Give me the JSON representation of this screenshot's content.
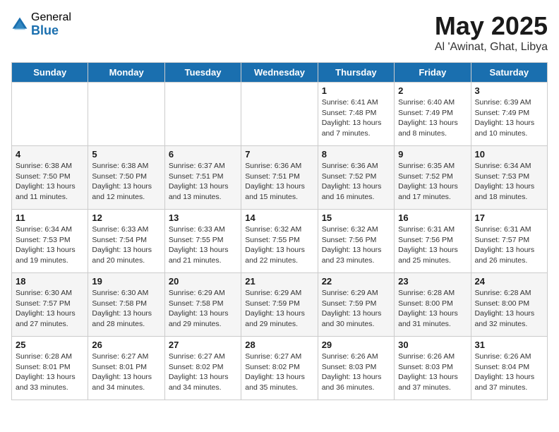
{
  "logo": {
    "general": "General",
    "blue": "Blue"
  },
  "title": "May 2025",
  "location": "Al 'Awinat, Ghat, Libya",
  "days_of_week": [
    "Sunday",
    "Monday",
    "Tuesday",
    "Wednesday",
    "Thursday",
    "Friday",
    "Saturday"
  ],
  "weeks": [
    [
      {
        "num": "",
        "info": ""
      },
      {
        "num": "",
        "info": ""
      },
      {
        "num": "",
        "info": ""
      },
      {
        "num": "",
        "info": ""
      },
      {
        "num": "1",
        "info": "Sunrise: 6:41 AM\nSunset: 7:48 PM\nDaylight: 13 hours\nand 7 minutes."
      },
      {
        "num": "2",
        "info": "Sunrise: 6:40 AM\nSunset: 7:49 PM\nDaylight: 13 hours\nand 8 minutes."
      },
      {
        "num": "3",
        "info": "Sunrise: 6:39 AM\nSunset: 7:49 PM\nDaylight: 13 hours\nand 10 minutes."
      }
    ],
    [
      {
        "num": "4",
        "info": "Sunrise: 6:38 AM\nSunset: 7:50 PM\nDaylight: 13 hours\nand 11 minutes."
      },
      {
        "num": "5",
        "info": "Sunrise: 6:38 AM\nSunset: 7:50 PM\nDaylight: 13 hours\nand 12 minutes."
      },
      {
        "num": "6",
        "info": "Sunrise: 6:37 AM\nSunset: 7:51 PM\nDaylight: 13 hours\nand 13 minutes."
      },
      {
        "num": "7",
        "info": "Sunrise: 6:36 AM\nSunset: 7:51 PM\nDaylight: 13 hours\nand 15 minutes."
      },
      {
        "num": "8",
        "info": "Sunrise: 6:36 AM\nSunset: 7:52 PM\nDaylight: 13 hours\nand 16 minutes."
      },
      {
        "num": "9",
        "info": "Sunrise: 6:35 AM\nSunset: 7:52 PM\nDaylight: 13 hours\nand 17 minutes."
      },
      {
        "num": "10",
        "info": "Sunrise: 6:34 AM\nSunset: 7:53 PM\nDaylight: 13 hours\nand 18 minutes."
      }
    ],
    [
      {
        "num": "11",
        "info": "Sunrise: 6:34 AM\nSunset: 7:53 PM\nDaylight: 13 hours\nand 19 minutes."
      },
      {
        "num": "12",
        "info": "Sunrise: 6:33 AM\nSunset: 7:54 PM\nDaylight: 13 hours\nand 20 minutes."
      },
      {
        "num": "13",
        "info": "Sunrise: 6:33 AM\nSunset: 7:55 PM\nDaylight: 13 hours\nand 21 minutes."
      },
      {
        "num": "14",
        "info": "Sunrise: 6:32 AM\nSunset: 7:55 PM\nDaylight: 13 hours\nand 22 minutes."
      },
      {
        "num": "15",
        "info": "Sunrise: 6:32 AM\nSunset: 7:56 PM\nDaylight: 13 hours\nand 23 minutes."
      },
      {
        "num": "16",
        "info": "Sunrise: 6:31 AM\nSunset: 7:56 PM\nDaylight: 13 hours\nand 25 minutes."
      },
      {
        "num": "17",
        "info": "Sunrise: 6:31 AM\nSunset: 7:57 PM\nDaylight: 13 hours\nand 26 minutes."
      }
    ],
    [
      {
        "num": "18",
        "info": "Sunrise: 6:30 AM\nSunset: 7:57 PM\nDaylight: 13 hours\nand 27 minutes."
      },
      {
        "num": "19",
        "info": "Sunrise: 6:30 AM\nSunset: 7:58 PM\nDaylight: 13 hours\nand 28 minutes."
      },
      {
        "num": "20",
        "info": "Sunrise: 6:29 AM\nSunset: 7:58 PM\nDaylight: 13 hours\nand 29 minutes."
      },
      {
        "num": "21",
        "info": "Sunrise: 6:29 AM\nSunset: 7:59 PM\nDaylight: 13 hours\nand 29 minutes."
      },
      {
        "num": "22",
        "info": "Sunrise: 6:29 AM\nSunset: 7:59 PM\nDaylight: 13 hours\nand 30 minutes."
      },
      {
        "num": "23",
        "info": "Sunrise: 6:28 AM\nSunset: 8:00 PM\nDaylight: 13 hours\nand 31 minutes."
      },
      {
        "num": "24",
        "info": "Sunrise: 6:28 AM\nSunset: 8:00 PM\nDaylight: 13 hours\nand 32 minutes."
      }
    ],
    [
      {
        "num": "25",
        "info": "Sunrise: 6:28 AM\nSunset: 8:01 PM\nDaylight: 13 hours\nand 33 minutes."
      },
      {
        "num": "26",
        "info": "Sunrise: 6:27 AM\nSunset: 8:01 PM\nDaylight: 13 hours\nand 34 minutes."
      },
      {
        "num": "27",
        "info": "Sunrise: 6:27 AM\nSunset: 8:02 PM\nDaylight: 13 hours\nand 34 minutes."
      },
      {
        "num": "28",
        "info": "Sunrise: 6:27 AM\nSunset: 8:02 PM\nDaylight: 13 hours\nand 35 minutes."
      },
      {
        "num": "29",
        "info": "Sunrise: 6:26 AM\nSunset: 8:03 PM\nDaylight: 13 hours\nand 36 minutes."
      },
      {
        "num": "30",
        "info": "Sunrise: 6:26 AM\nSunset: 8:03 PM\nDaylight: 13 hours\nand 37 minutes."
      },
      {
        "num": "31",
        "info": "Sunrise: 6:26 AM\nSunset: 8:04 PM\nDaylight: 13 hours\nand 37 minutes."
      }
    ]
  ]
}
